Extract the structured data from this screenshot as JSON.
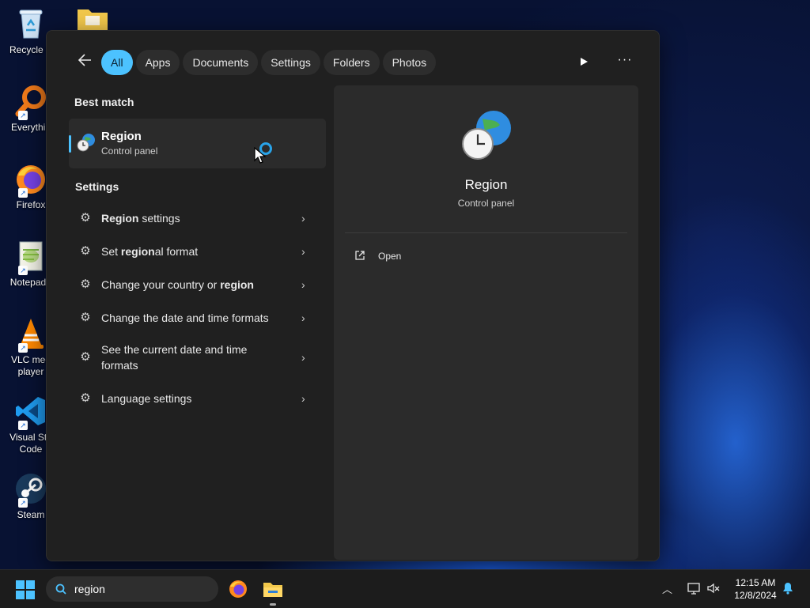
{
  "desktop": {
    "icons": [
      {
        "label": "Recycle B",
        "icon": "recycle-bin-icon"
      },
      {
        "label": "Everythin",
        "icon": "everything-search-icon"
      },
      {
        "label": "Firefox",
        "icon": "firefox-icon"
      },
      {
        "label": "Notepad+",
        "icon": "notepad-plus-icon"
      },
      {
        "label": "VLC med player",
        "icon": "vlc-icon"
      },
      {
        "label": "Visual Stu Code",
        "icon": "vscode-icon"
      },
      {
        "label": "Steam",
        "icon": "steam-icon"
      }
    ],
    "folder_icon": "folder-icon"
  },
  "search": {
    "filters": [
      "All",
      "Apps",
      "Documents",
      "Settings",
      "Folders",
      "Photos"
    ],
    "active_filter": "All",
    "best_match_heading": "Best match",
    "best_match": {
      "title": "Region",
      "subtitle": "Control panel"
    },
    "settings_heading": "Settings",
    "settings_items": [
      {
        "pre": "",
        "bold": "Region",
        "post": " settings"
      },
      {
        "pre": "Set ",
        "bold": "region",
        "post": "al format"
      },
      {
        "pre": "Change your country or ",
        "bold": "region",
        "post": ""
      },
      {
        "pre": "Change the date and time formats",
        "bold": "",
        "post": ""
      },
      {
        "pre": "See the current date and time formats",
        "bold": "",
        "post": ""
      },
      {
        "pre": "Language settings",
        "bold": "",
        "post": ""
      }
    ],
    "preview": {
      "title": "Region",
      "subtitle": "Control panel",
      "action": "Open"
    }
  },
  "taskbar": {
    "search_value": "region",
    "time": "12:15 AM",
    "date": "12/8/2024"
  },
  "colors": {
    "accent": "#4cc2ff",
    "panel": "#202020",
    "card": "#2b2b2b"
  }
}
